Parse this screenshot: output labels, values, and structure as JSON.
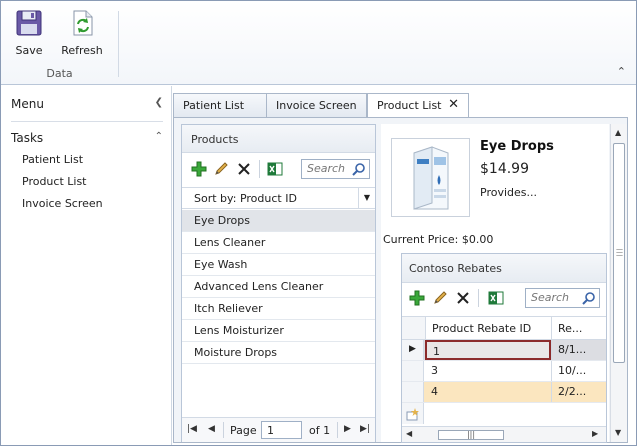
{
  "ribbon": {
    "save_label": "Save",
    "refresh_label": "Refresh",
    "group_label": "Data"
  },
  "nav": {
    "menu_label": "Menu",
    "tasks_label": "Tasks",
    "items": [
      {
        "label": "Patient List"
      },
      {
        "label": "Product List"
      },
      {
        "label": "Invoice Screen"
      }
    ]
  },
  "tabs": [
    {
      "label": "Patient List"
    },
    {
      "label": "Invoice Screen"
    },
    {
      "label": "Product List",
      "active": true
    }
  ],
  "products": {
    "title": "Products",
    "search_placeholder": "Search",
    "sort_label": "Sort by: Product ID",
    "items": [
      {
        "name": "Eye Drops",
        "selected": true
      },
      {
        "name": "Lens Cleaner"
      },
      {
        "name": "Eye Wash"
      },
      {
        "name": "Advanced Lens Cleaner"
      },
      {
        "name": "Itch Reliever"
      },
      {
        "name": "Lens Moisturizer"
      },
      {
        "name": "Moisture Drops"
      }
    ],
    "pager": {
      "page_label": "Page",
      "page_value": "1",
      "of_label": "of 1"
    }
  },
  "detail": {
    "name": "Eye Drops",
    "price": "$14.99",
    "description": "Provides...",
    "current_price": "Current Price: $0.00"
  },
  "rebates": {
    "title": "Contoso Rebates",
    "search_placeholder": "Search",
    "columns": [
      "Product Rebate ID",
      "Re..."
    ],
    "rows": [
      {
        "id": "1",
        "re": "8/1...",
        "current": true
      },
      {
        "id": "3",
        "re": "10/..."
      },
      {
        "id": "4",
        "re": "2/2...",
        "alt": true
      }
    ]
  },
  "colors": {
    "accent_border": "#8a9bb5",
    "selected_row": "#e1e4e9",
    "alt_row": "#fbe6bf",
    "current_cell_border": "#8c2a2a"
  }
}
